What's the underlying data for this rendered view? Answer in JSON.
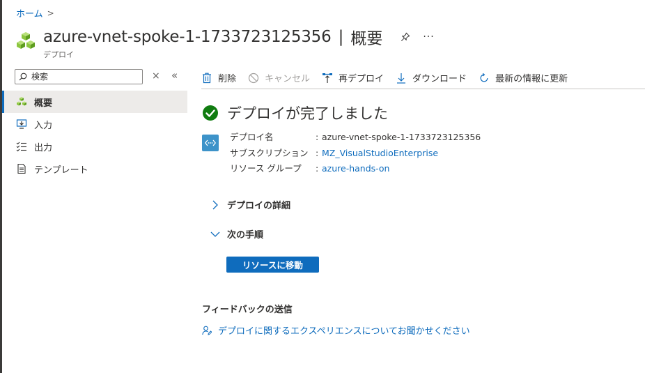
{
  "breadcrumb": {
    "home": "ホーム"
  },
  "header": {
    "title": "azure-vnet-spoke-1-1733723125356",
    "separator": "|",
    "section": "概要",
    "subtitle": "デプロイ",
    "more": "···"
  },
  "search": {
    "placeholder": "検索",
    "clear": "×",
    "collapse": "«"
  },
  "sidebar": {
    "items": [
      {
        "label": "概要",
        "icon": "overview-icon",
        "active": true
      },
      {
        "label": "入力",
        "icon": "input-icon",
        "active": false
      },
      {
        "label": "出力",
        "icon": "output-icon",
        "active": false
      },
      {
        "label": "テンプレート",
        "icon": "template-icon",
        "active": false
      }
    ]
  },
  "toolbar": {
    "delete": "削除",
    "cancel": "キャンセル",
    "redeploy": "再デプロイ",
    "download": "ダウンロード",
    "refresh": "最新の情報に更新"
  },
  "status": {
    "title": "デプロイが完了しました"
  },
  "details": {
    "colon": ":",
    "rows": [
      {
        "key": "デプロイ名",
        "value": "azure-vnet-spoke-1-1733723125356",
        "link": false
      },
      {
        "key": "サブスクリプション",
        "value": "MZ_VisualStudioEnterprise",
        "link": true
      },
      {
        "key": "リソース グループ",
        "value": "azure-hands-on",
        "link": true
      }
    ]
  },
  "sections": {
    "deploy_details": "デプロイの詳細",
    "next_steps": "次の手順"
  },
  "next_steps": {
    "go_to_resource": "リソースに移動"
  },
  "feedback": {
    "title": "フィードバックの送信",
    "link": "デプロイに関するエクスペリエンスについてお聞かせください"
  },
  "colors": {
    "accent": "#0f6cbd",
    "success": "#107c10",
    "tile": "#3d93c9",
    "resource_green": "#8cc63f"
  }
}
